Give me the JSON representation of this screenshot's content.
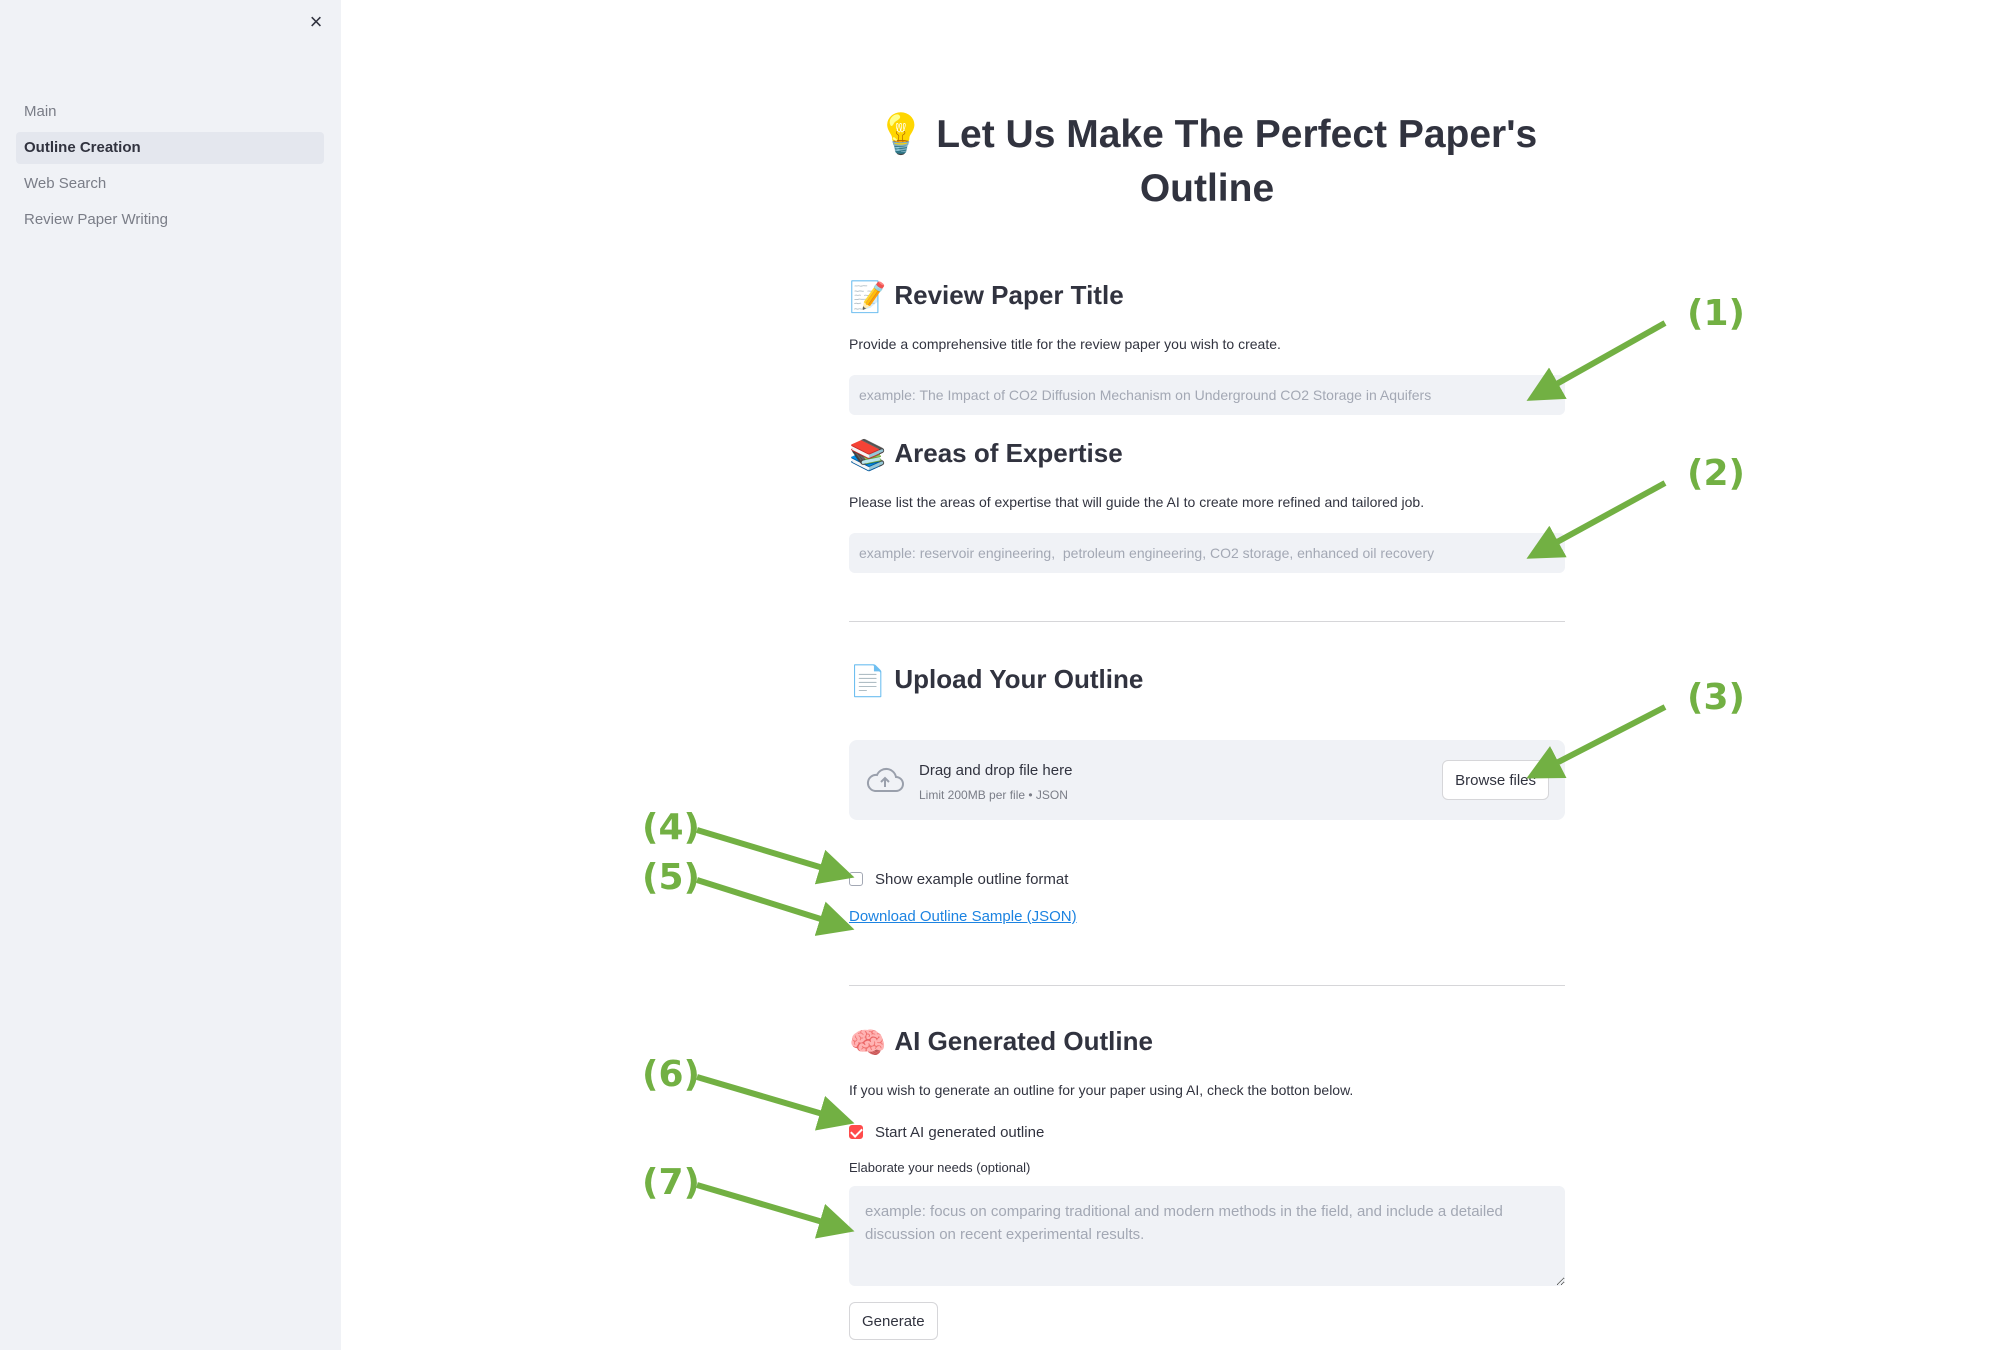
{
  "sidebar": {
    "close_icon": "×",
    "items": [
      {
        "label": "Main"
      },
      {
        "label": "Outline Creation"
      },
      {
        "label": "Web Search"
      },
      {
        "label": "Review Paper Writing"
      }
    ]
  },
  "main": {
    "title_emoji": "💡",
    "title": "Let Us Make The Perfect Paper's Outline",
    "title_section": {
      "emoji": "📝",
      "heading": "Review Paper Title",
      "description": "Provide a comprehensive title for the review paper you wish to create.",
      "placeholder": "example: The Impact of CO2 Diffusion Mechanism on Underground CO2 Storage in Aquifers"
    },
    "expertise_section": {
      "emoji": "📚",
      "heading": "Areas of Expertise",
      "description": "Please list the areas of expertise that will guide the AI to create more refined and tailored job.",
      "placeholder": "example: reservoir engineering,  petroleum engineering, CO2 storage, enhanced oil recovery"
    },
    "upload_section": {
      "emoji": "📄",
      "heading": "Upload Your Outline",
      "dropzone_title": "Drag and drop file here",
      "dropzone_limit": "Limit 200MB per file • JSON",
      "browse_label": "Browse files",
      "show_example_label": "Show example outline format",
      "show_example_checked": false,
      "download_link": "Download Outline Sample (JSON)"
    },
    "ai_section": {
      "emoji": "🧠",
      "heading": "AI Generated Outline",
      "description": "If you wish to generate an outline for your paper using AI, check the botton below.",
      "start_label": "Start AI generated outline",
      "start_checked": true,
      "needs_label": "Elaborate your needs (optional)",
      "needs_placeholder": "example: focus on comparing traditional and modern methods in the field, and include a detailed discussion on recent experimental results.",
      "generate_label": "Generate"
    }
  },
  "annotations": [
    "(1)",
    "(2)",
    "(3)",
    "(4)",
    "(5)",
    "(6)",
    "(7)"
  ],
  "colors": {
    "annotation": "#72b043",
    "accent": "#ff4b4b",
    "link": "#1c83e1",
    "sidebar_bg": "#f0f2f6"
  }
}
